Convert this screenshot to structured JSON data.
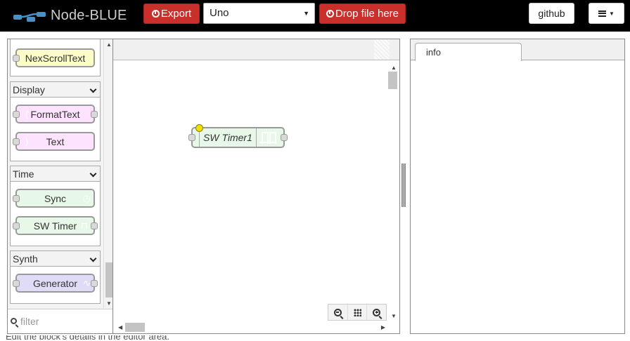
{
  "header": {
    "app_name": "Node-BLUE",
    "export_label": "Export",
    "board_selected": "Uno",
    "drop_label": "Drop file here",
    "github_label": "github",
    "menu_icon": "hamburger-menu-icon"
  },
  "palette": {
    "top_partial_node": "NexScrollText",
    "categories": [
      {
        "name": "Display",
        "nodes": [
          "FormatText",
          "Text"
        ]
      },
      {
        "name": "Time",
        "nodes": [
          "Sync",
          "SW Timer"
        ]
      },
      {
        "name": "Synth",
        "nodes": [
          "Generator"
        ]
      }
    ],
    "filter_placeholder": "filter",
    "colors": {
      "display": "#fde3fd",
      "time": "#e8f8e8",
      "synth": "#e0dcf8",
      "scroll_text": "#fcfcc8"
    }
  },
  "workspace": {
    "flow_nodes": [
      {
        "label": "SW Timer1",
        "status": "yellow",
        "color": "#e8f8e8"
      }
    ],
    "zoom_controls": [
      "zoom-out-icon",
      "zoom-reset-icon",
      "zoom-in-icon"
    ]
  },
  "sidebar": {
    "tabs": [
      "info"
    ]
  },
  "footer_text": "Edit the block's details in the editor area."
}
